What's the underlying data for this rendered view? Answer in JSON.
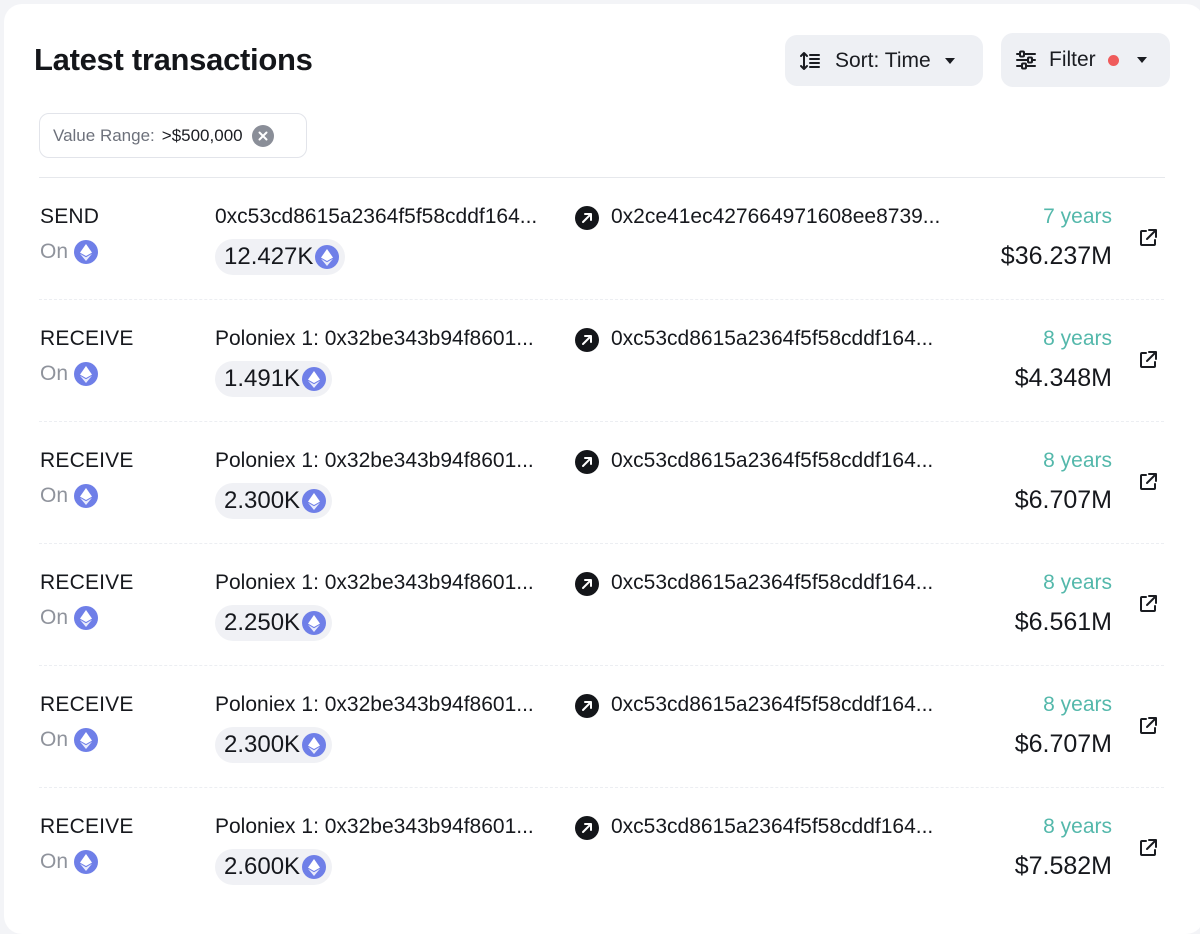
{
  "header": {
    "title": "Latest transactions",
    "sort_label": "Sort: Time",
    "filter_label": "Filter"
  },
  "filter_chip": {
    "label": "Value Range:",
    "value": ">$500,000"
  },
  "on_label": "On",
  "transactions": [
    {
      "type": "SEND",
      "from": "0xc53cd8615a2364f5f58cddf164...",
      "to": "0x2ce41ec427664971608ee8739...",
      "amount": "12.427K",
      "age": "7 years",
      "usd": "$36.237M"
    },
    {
      "type": "RECEIVE",
      "from": "Poloniex 1: 0x32be343b94f8601...",
      "to": "0xc53cd8615a2364f5f58cddf164...",
      "amount": "1.491K",
      "age": "8 years",
      "usd": "$4.348M"
    },
    {
      "type": "RECEIVE",
      "from": "Poloniex 1: 0x32be343b94f8601...",
      "to": "0xc53cd8615a2364f5f58cddf164...",
      "amount": "2.300K",
      "age": "8 years",
      "usd": "$6.707M"
    },
    {
      "type": "RECEIVE",
      "from": "Poloniex 1: 0x32be343b94f8601...",
      "to": "0xc53cd8615a2364f5f58cddf164...",
      "amount": "2.250K",
      "age": "8 years",
      "usd": "$6.561M"
    },
    {
      "type": "RECEIVE",
      "from": "Poloniex 1: 0x32be343b94f8601...",
      "to": "0xc53cd8615a2364f5f58cddf164...",
      "amount": "2.300K",
      "age": "8 years",
      "usd": "$6.707M"
    },
    {
      "type": "RECEIVE",
      "from": "Poloniex 1: 0x32be343b94f8601...",
      "to": "0xc53cd8615a2364f5f58cddf164...",
      "amount": "2.600K",
      "age": "8 years",
      "usd": "$7.582M"
    }
  ],
  "icons": {
    "sort": "sort-icon",
    "filter": "sliders-icon",
    "chip_close": "close-circle-icon",
    "chain": "ethereum-icon",
    "direction": "arrow-up-right-icon",
    "external": "external-link-icon"
  },
  "colors": {
    "age_text": "#54b8ab",
    "filter_dot": "#ef5b5b",
    "eth_badge": "#6f7fe8",
    "button_bg": "#eef0f4"
  }
}
